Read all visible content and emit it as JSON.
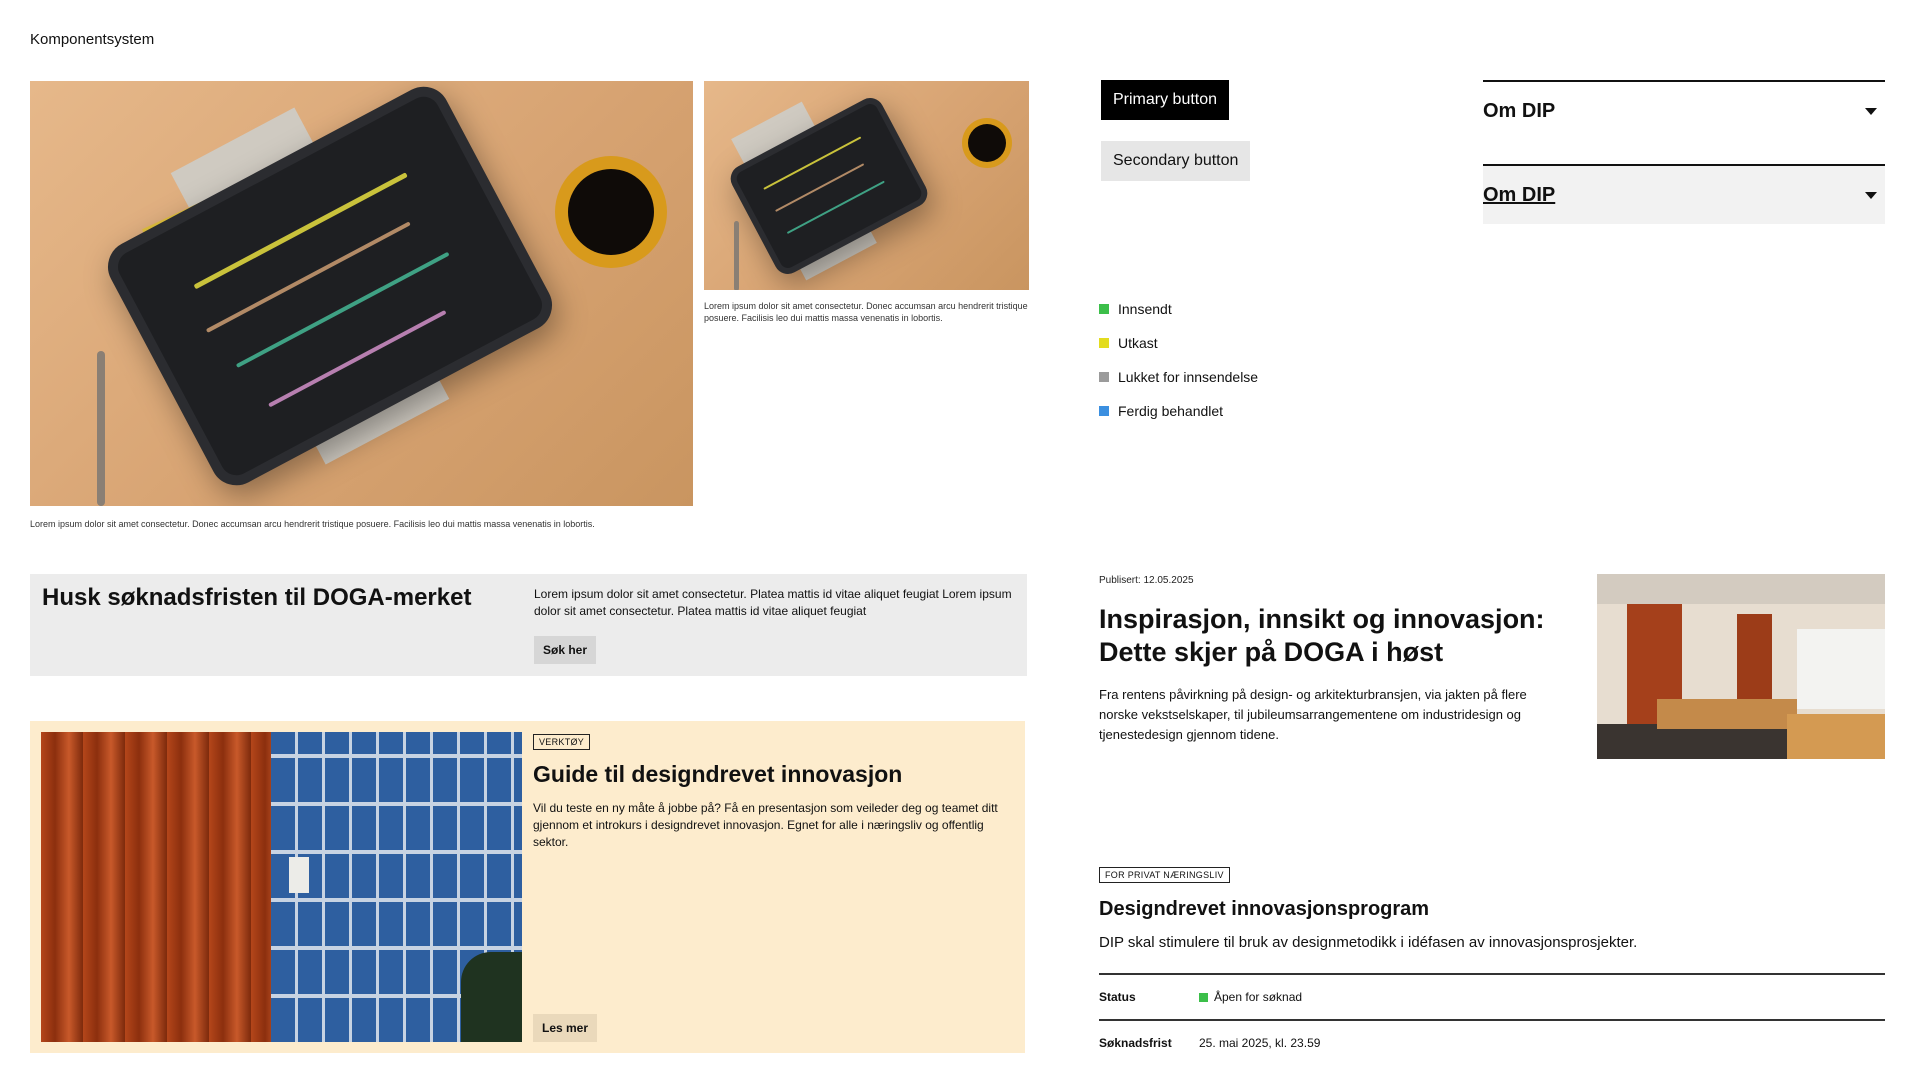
{
  "page": {
    "label": "Komponentsystem"
  },
  "captions": {
    "large": "Lorem ipsum dolor sit amet consectetur. Donec accumsan arcu hendrerit tristique posuere. Facilisis leo dui mattis massa venenatis in lobortis.",
    "small": "Lorem ipsum dolor sit amet consectetur. Donec accumsan arcu hendrerit tristique posuere. Facilisis leo dui mattis massa venenatis in lobortis."
  },
  "buttons": {
    "primary": "Primary button",
    "secondary": "Secondary button"
  },
  "accordions": [
    {
      "title": "Om DIP"
    },
    {
      "title": "Om DIP"
    }
  ],
  "legend": [
    {
      "label": "Innsendt",
      "color": "#3cbf4a"
    },
    {
      "label": "Utkast",
      "color": "#e3dc1f"
    },
    {
      "label": "Lukket for innsendelse",
      "color": "#9b9b9b"
    },
    {
      "label": "Ferdig behandlet",
      "color": "#3b8fe0"
    }
  ],
  "deadline": {
    "title": "Husk søknadsfristen til DOGA-merket",
    "text": "Lorem ipsum dolor sit amet consectetur. Platea mattis id vitae aliquet feugiat Lorem ipsum dolor sit amet consectetur. Platea mattis id vitae aliquet feugiat",
    "button": "Søk her"
  },
  "promo": {
    "tag": "VERKTØY",
    "title": "Guide til designdrevet innovasjon",
    "text": "Vil du teste en ny måte å jobbe på? Få en presentasjon som veileder deg og teamet ditt gjennom et introkurs i designdrevet innovasjon. Egnet for alle i næringsliv og offentlig sektor.",
    "button": "Les mer"
  },
  "article": {
    "published": "Publisert: 12.05.2025",
    "title": "Inspirasjon, innsikt og innovasjon: Dette skjer på DOGA i høst",
    "text": "Fra rentens påvirkning på design- og arkitekturbransjen, via jakten på flere norske vekstselskaper, til jubileumsarrangementene om industridesign og tjenestedesign gjennom tidene."
  },
  "program": {
    "tag": "FOR PRIVAT NÆRINGSLIV",
    "title": "Designdrevet innovasjonsprogram",
    "description": "DIP skal stimulere til bruk av designmetodikk i idéfasen av innovasjonsprosjekter.",
    "rows": [
      {
        "key": "Status",
        "value": "Åpen for søknad",
        "dot": "#3cbf4a"
      },
      {
        "key": "Søknadsfrist",
        "value": "25. mai 2025, kl. 23.59"
      }
    ]
  }
}
